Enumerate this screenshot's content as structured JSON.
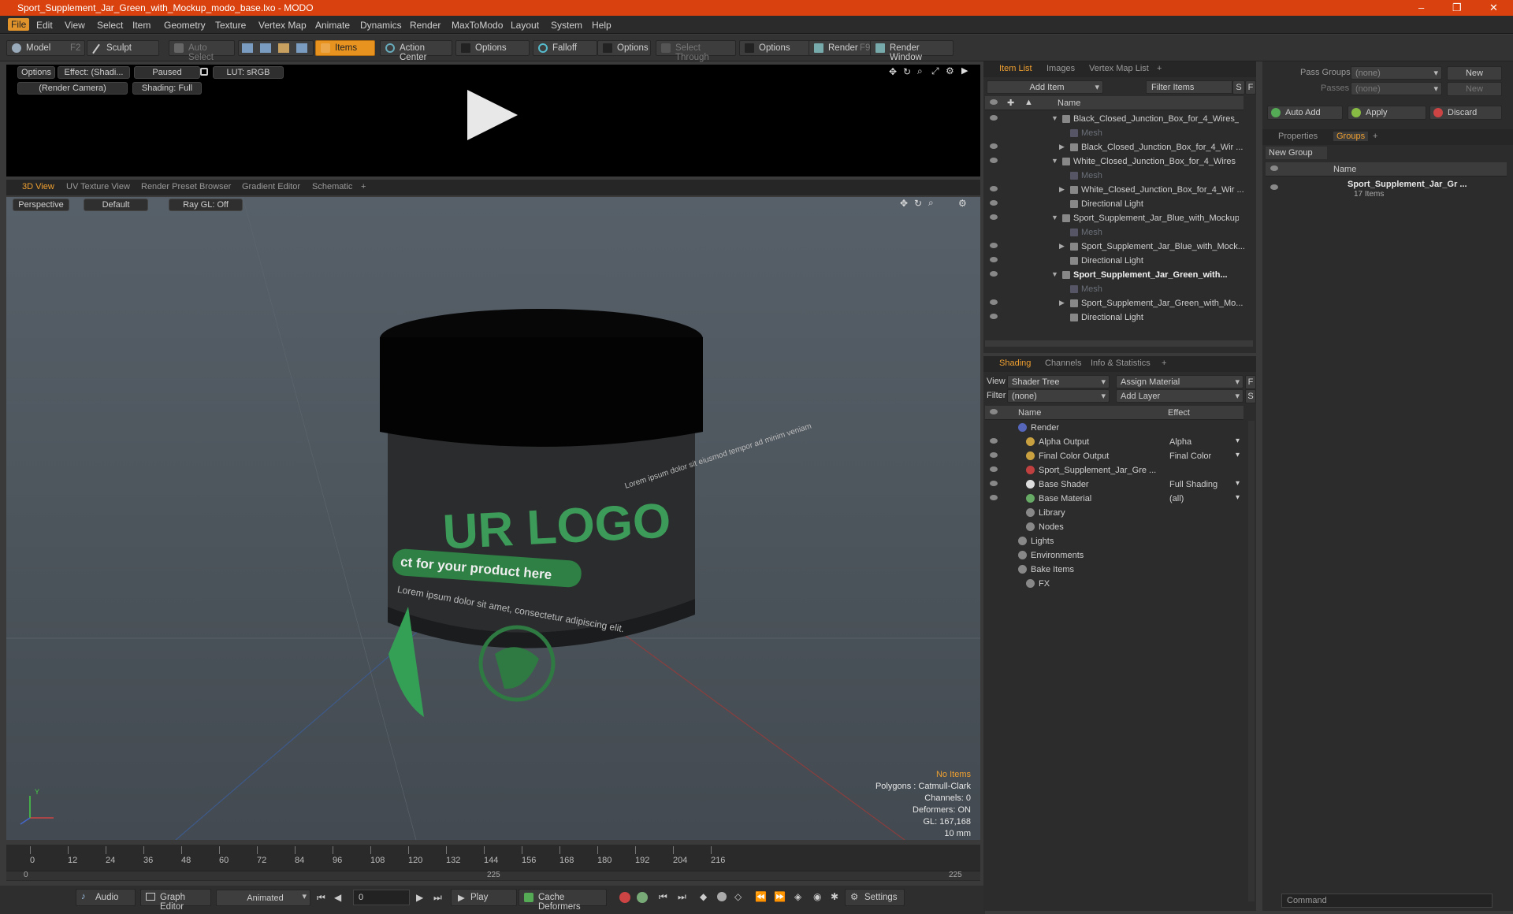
{
  "window": {
    "title": "Sport_Supplement_Jar_Green_with_Mockup_modo_base.lxo - MODO",
    "controls": [
      "–",
      "❐",
      "✕"
    ]
  },
  "menu": [
    "File",
    "Edit",
    "View",
    "Select",
    "Item",
    "Geometry",
    "Texture",
    "Vertex Map",
    "Animate",
    "Dynamics",
    "Render",
    "MaxToModo",
    "Layout",
    "System",
    "Help"
  ],
  "toolbar": {
    "model": "Model",
    "model_key": "F2",
    "sculpt": "Sculpt",
    "auto_select": "Auto Select",
    "items": "Items",
    "action_center": "Action Center",
    "options1": "Options",
    "falloff": "Falloff",
    "options2": "Options",
    "select_through": "Select Through",
    "options3": "Options",
    "render": "Render",
    "render_key": "F9",
    "render_window": "Render Window"
  },
  "preview": {
    "options": "Options",
    "effect": "Effect: (Shadi...",
    "paused": "Paused",
    "lut": "LUT: sRGB",
    "camera": "(Render Camera)",
    "shading": "Shading: Full"
  },
  "viewtabs": [
    "3D View",
    "UV Texture View",
    "Render Preset Browser",
    "Gradient Editor",
    "Schematic",
    "+"
  ],
  "viewport": {
    "perspective": "Perspective",
    "default": "Default",
    "raygl": "Ray GL: Off",
    "no_items": "No Items",
    "polygons": "Polygons : Catmull-Clark",
    "channels": "Channels: 0",
    "deformers": "Deformers: ON",
    "gl": "GL: 167,168",
    "scale": "10 mm",
    "label_logo": "UR LOGO",
    "label_banner": "ct for your product here",
    "label_body": "Lorem ipsum dolor sit amet, consectetur adipiscing elit.",
    "label_right": "Lorem ipsum dolor sit eiusmod tempor ad minim veniam"
  },
  "timeline": {
    "ticks": [
      "0",
      "12",
      "24",
      "36",
      "48",
      "60",
      "72",
      "84",
      "96",
      "108",
      "120",
      "132",
      "144",
      "156",
      "168",
      "180",
      "192",
      "204",
      "216"
    ],
    "lower": [
      "0",
      "225",
      "225"
    ]
  },
  "transport": {
    "audio": "Audio",
    "graph_editor": "Graph Editor",
    "animated": "Animated",
    "frame": "0",
    "play": "Play",
    "cache": "Cache Deformers",
    "settings": "Settings"
  },
  "itemlist": {
    "tabs": [
      "Item List",
      "Images",
      "Vertex Map List",
      "+"
    ],
    "add_item": "Add Item",
    "filter": "Filter Items",
    "s": "S",
    "f": "F",
    "col_name": "Name",
    "rows": [
      {
        "label": "Black_Closed_Junction_Box_for_4_Wires_...",
        "indent": 0,
        "bold": false,
        "dim": false
      },
      {
        "label": "Mesh",
        "indent": 1,
        "bold": false,
        "dim": true
      },
      {
        "label": "Black_Closed_Junction_Box_for_4_Wir ...",
        "indent": 1,
        "bold": false,
        "dim": false
      },
      {
        "label": "White_Closed_Junction_Box_for_4_Wires ...",
        "indent": 0,
        "bold": false,
        "dim": false
      },
      {
        "label": "Mesh",
        "indent": 1,
        "bold": false,
        "dim": true
      },
      {
        "label": "White_Closed_Junction_Box_for_4_Wir ...",
        "indent": 1,
        "bold": false,
        "dim": false
      },
      {
        "label": "Directional Light",
        "indent": 1,
        "bold": false,
        "dim": false
      },
      {
        "label": "Sport_Supplement_Jar_Blue_with_Mockup...",
        "indent": 0,
        "bold": false,
        "dim": false
      },
      {
        "label": "Mesh",
        "indent": 1,
        "bold": false,
        "dim": true
      },
      {
        "label": "Sport_Supplement_Jar_Blue_with_Mock...",
        "indent": 1,
        "bold": false,
        "dim": false
      },
      {
        "label": "Directional Light",
        "indent": 1,
        "bold": false,
        "dim": false
      },
      {
        "label": "Sport_Supplement_Jar_Green_with...",
        "indent": 0,
        "bold": true,
        "dim": false
      },
      {
        "label": "Mesh",
        "indent": 1,
        "bold": false,
        "dim": true
      },
      {
        "label": "Sport_Supplement_Jar_Green_with_Mo...",
        "indent": 1,
        "bold": false,
        "dim": false
      },
      {
        "label": "Directional Light",
        "indent": 1,
        "bold": false,
        "dim": false
      }
    ]
  },
  "shading": {
    "tabs": [
      "Shading",
      "Channels",
      "Info & Statistics",
      "+"
    ],
    "view_label": "View",
    "view_value": "Shader Tree",
    "assign": "Assign Material",
    "f": "F",
    "filter_label": "Filter",
    "filter_value": "(none)",
    "add_layer": "Add Layer",
    "s": "S",
    "col_name": "Name",
    "col_effect": "Effect",
    "rows": [
      {
        "label": "Render",
        "effect": "",
        "indent": 0
      },
      {
        "label": "Alpha Output",
        "effect": "Alpha",
        "indent": 1
      },
      {
        "label": "Final Color Output",
        "effect": "Final Color",
        "indent": 1
      },
      {
        "label": "Sport_Supplement_Jar_Gre ...",
        "effect": "",
        "indent": 1
      },
      {
        "label": "Base Shader",
        "effect": "Full Shading",
        "indent": 1
      },
      {
        "label": "Base Material",
        "effect": "(all)",
        "indent": 1
      },
      {
        "label": "Library",
        "effect": "",
        "indent": 1
      },
      {
        "label": "Nodes",
        "effect": "",
        "indent": 1
      },
      {
        "label": "Lights",
        "effect": "",
        "indent": 0
      },
      {
        "label": "Environments",
        "effect": "",
        "indent": 0
      },
      {
        "label": "Bake Items",
        "effect": "",
        "indent": 0
      },
      {
        "label": "FX",
        "effect": "",
        "indent": 1
      }
    ]
  },
  "right": {
    "pass_groups": "Pass Groups",
    "pass_groups_val": "(none)",
    "new": "New",
    "passes": "Passes",
    "passes_val": "(none)",
    "new2": "New",
    "auto_add": "Auto Add",
    "apply": "Apply",
    "discard": "Discard",
    "tabs": [
      "Properties",
      "Groups",
      "+"
    ],
    "new_group": "New Group",
    "col_name": "Name",
    "group_name": "Sport_Supplement_Jar_Gr ...",
    "group_count": "17 Items",
    "command": "Command"
  },
  "colors": {
    "accent": "#e8921f",
    "title": "#d9420f"
  }
}
